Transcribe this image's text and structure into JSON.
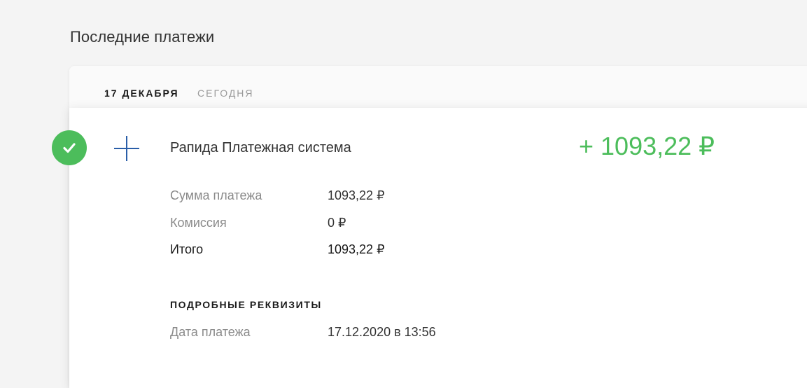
{
  "page": {
    "title": "Последние платежи"
  },
  "date_group": {
    "date": "17 ДЕКАБРЯ",
    "relative": "СЕГОДНЯ"
  },
  "payment": {
    "status_icon": "checkmark-icon",
    "type_icon": "plus-icon",
    "merchant": "Рапида Платежная система",
    "amount": "+ 1093,22 ₽",
    "rows": [
      {
        "label": "Сумма платежа",
        "value": "1093,22 ₽"
      },
      {
        "label": "Комиссия",
        "value": "0 ₽"
      },
      {
        "label": "Итого",
        "value": "1093,22 ₽"
      }
    ],
    "details": {
      "title": "ПОДРОБНЫЕ РЕКВИЗИТЫ",
      "rows": [
        {
          "label": "Дата платежа",
          "value": "17.12.2020 в 13:56"
        }
      ]
    }
  },
  "colors": {
    "success": "#4cbd5b",
    "accent_blue": "#2a5ea8",
    "background": "#f4f4f4"
  }
}
